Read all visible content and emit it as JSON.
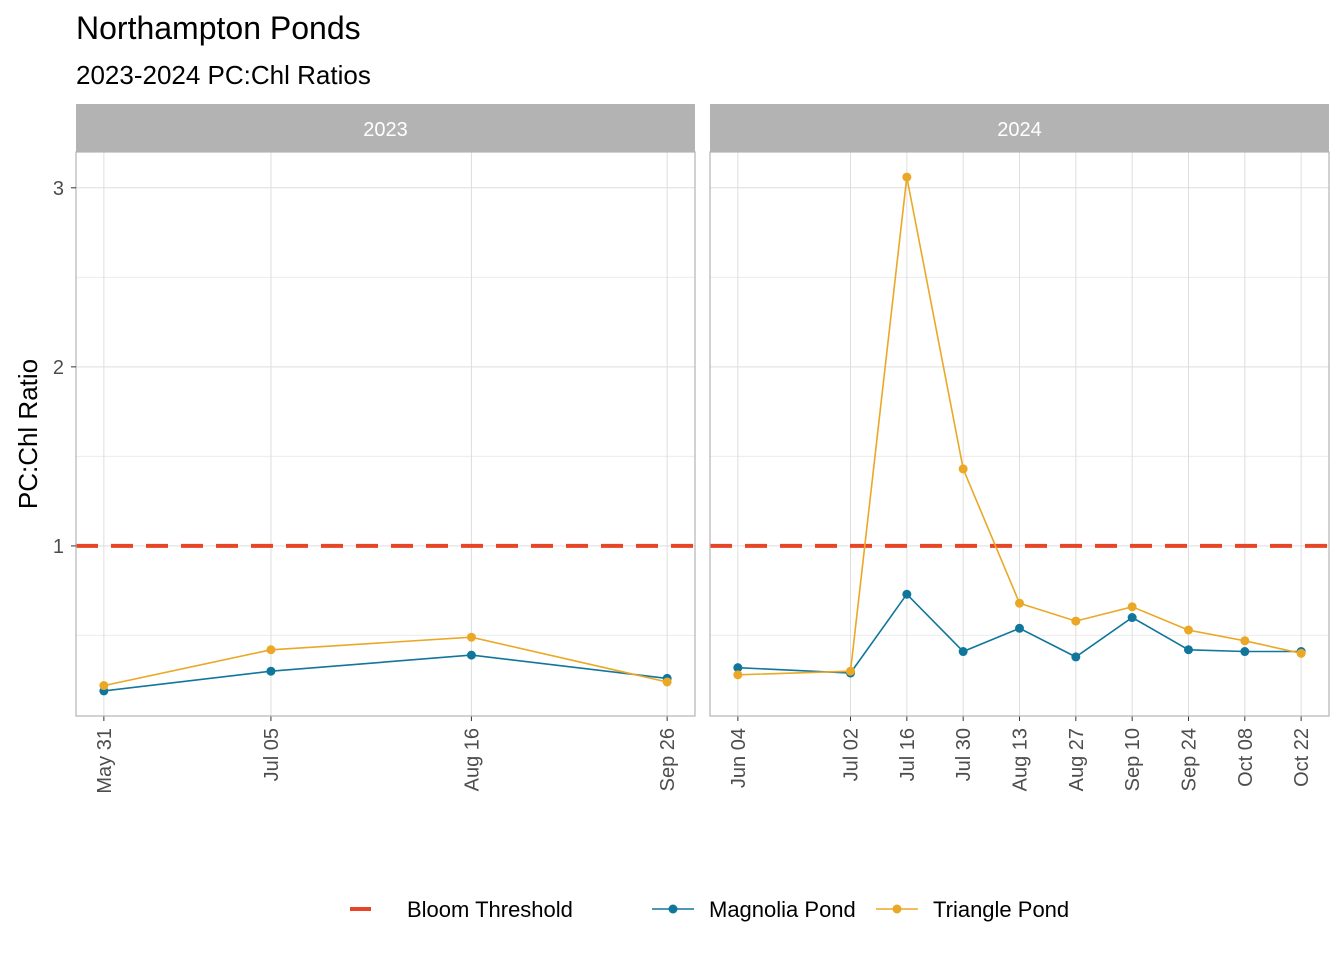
{
  "title": "Northampton Ponds",
  "subtitle": "2023-2024 PC:Chl Ratios",
  "chart_data": {
    "type": "line",
    "ylabel": "PC:Chl Ratio",
    "ylim": [
      0.05,
      3.2
    ],
    "y_ticks": [
      1,
      2,
      3
    ],
    "threshold": {
      "name": "Bloom Threshold",
      "value": 1,
      "color": "#E84527"
    },
    "colors": {
      "Magnolia Pond": "#10769B",
      "Triangle Pond": "#EBA826"
    },
    "legend": {
      "position": "bottom",
      "items": [
        {
          "label": "Bloom Threshold",
          "kind": "dashed",
          "color": "#E84527"
        },
        {
          "label": "Magnolia Pond",
          "kind": "line-point",
          "color": "#10769B"
        },
        {
          "label": "Triangle Pond",
          "kind": "line-point",
          "color": "#EBA826"
        }
      ]
    },
    "panels": [
      {
        "strip": "2023",
        "x_ticks": [
          "May 31",
          "Jul 05",
          "Aug 16",
          "Sep 26"
        ],
        "x_tick_dates": [
          "2023-05-31",
          "2023-07-05",
          "2023-08-16",
          "2023-09-26"
        ],
        "x_range": [
          "2023-05-31",
          "2023-09-26"
        ],
        "series": [
          {
            "name": "Magnolia Pond",
            "x": [
              "2023-05-31",
              "2023-07-05",
              "2023-08-16",
              "2023-09-26"
            ],
            "y": [
              0.19,
              0.3,
              0.39,
              0.26
            ]
          },
          {
            "name": "Triangle Pond",
            "x": [
              "2023-05-31",
              "2023-07-05",
              "2023-08-16",
              "2023-09-26"
            ],
            "y": [
              0.22,
              0.42,
              0.49,
              0.24
            ]
          }
        ]
      },
      {
        "strip": "2024",
        "x_ticks": [
          "Jun 04",
          "Jul 02",
          "Jul 16",
          "Jul 30",
          "Aug 13",
          "Aug 27",
          "Sep 10",
          "Sep 24",
          "Oct 08",
          "Oct 22"
        ],
        "x_tick_dates": [
          "2024-06-04",
          "2024-07-02",
          "2024-07-16",
          "2024-07-30",
          "2024-08-13",
          "2024-08-27",
          "2024-09-10",
          "2024-09-24",
          "2024-10-08",
          "2024-10-22"
        ],
        "x_range": [
          "2024-06-04",
          "2024-10-22"
        ],
        "series": [
          {
            "name": "Magnolia Pond",
            "x": [
              "2024-06-04",
              "2024-07-02",
              "2024-07-16",
              "2024-07-30",
              "2024-08-13",
              "2024-08-27",
              "2024-09-10",
              "2024-09-24",
              "2024-10-08",
              "2024-10-22"
            ],
            "y": [
              0.32,
              0.29,
              0.73,
              0.41,
              0.54,
              0.38,
              0.6,
              0.42,
              0.41,
              0.41
            ]
          },
          {
            "name": "Triangle Pond",
            "x": [
              "2024-06-04",
              "2024-07-02",
              "2024-07-16",
              "2024-07-30",
              "2024-08-13",
              "2024-08-27",
              "2024-09-10",
              "2024-09-24",
              "2024-10-08",
              "2024-10-22"
            ],
            "y": [
              0.28,
              0.3,
              3.06,
              1.43,
              0.68,
              0.58,
              0.66,
              0.53,
              0.47,
              0.4
            ]
          }
        ]
      }
    ]
  }
}
